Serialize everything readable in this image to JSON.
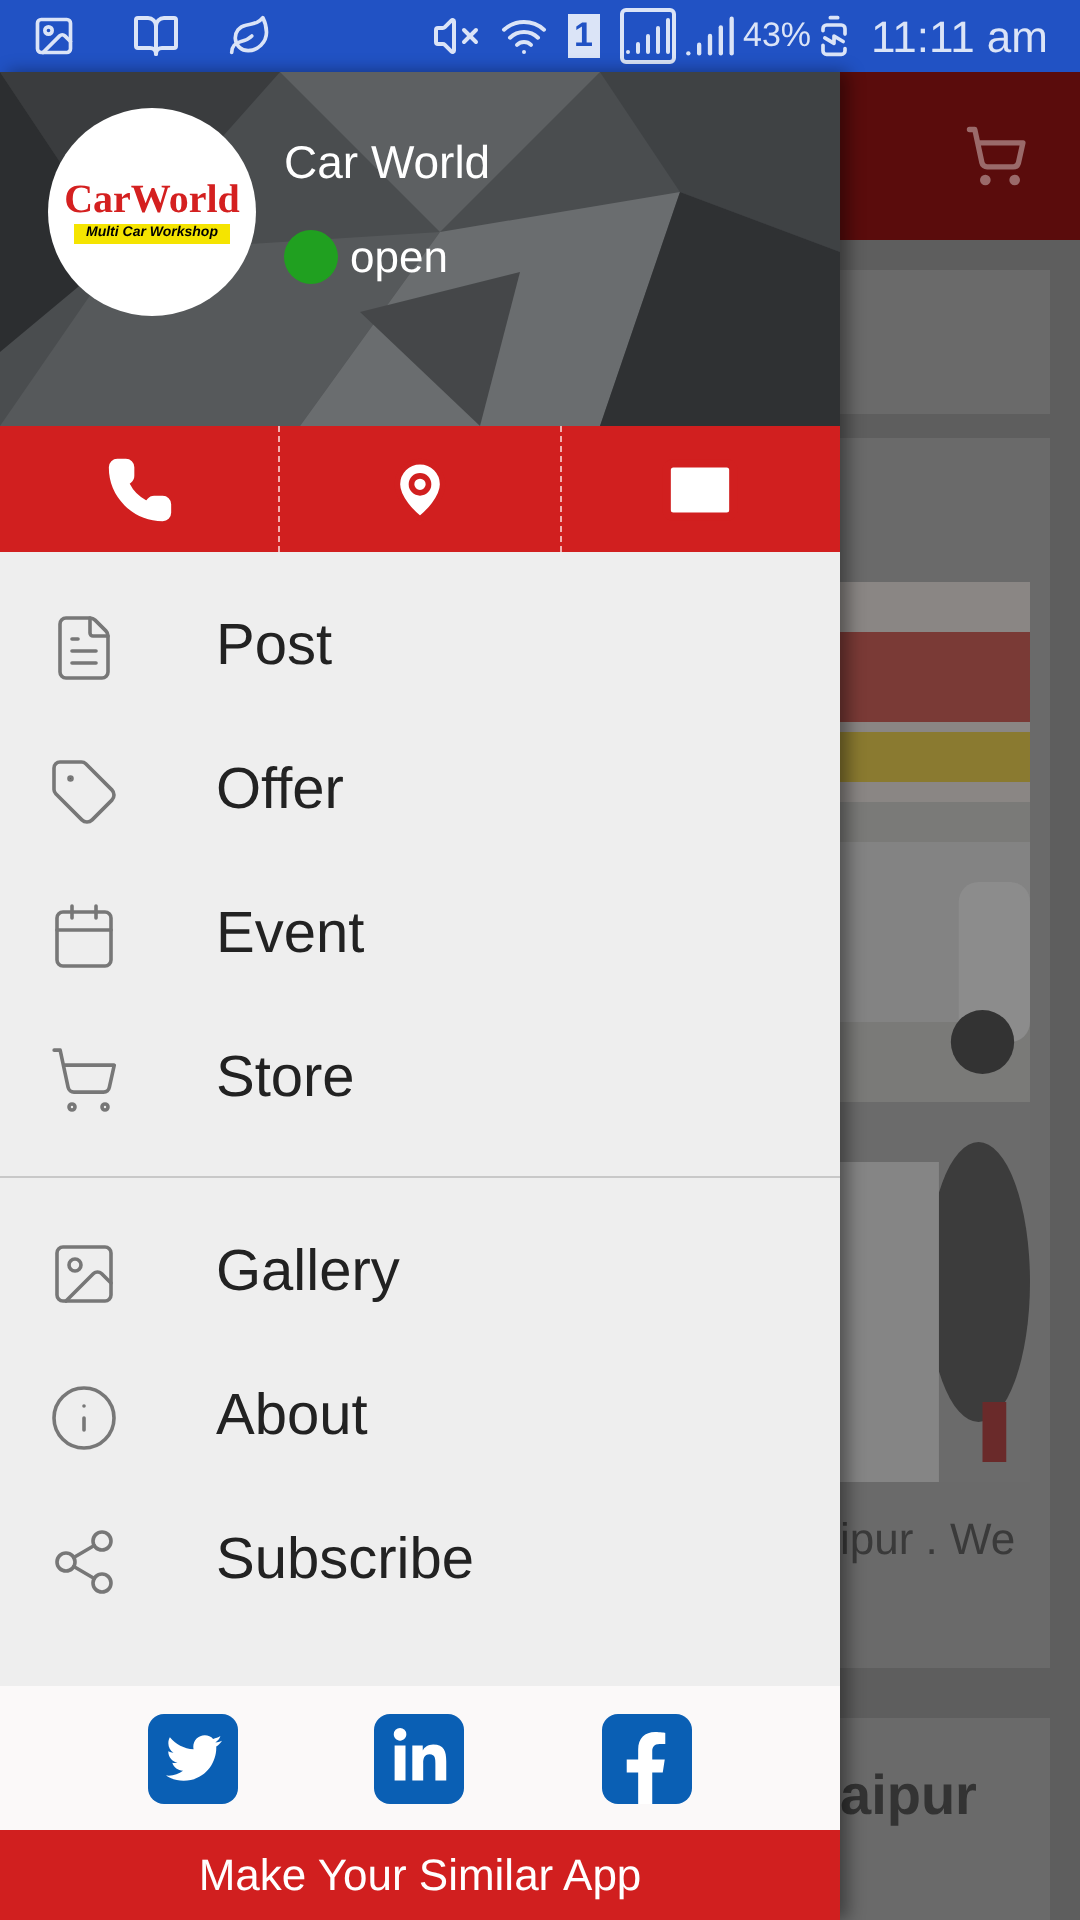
{
  "status_bar": {
    "sim": "1",
    "battery": "43%",
    "time": "11:11 am"
  },
  "drawer": {
    "logo": {
      "name": "CarWorld",
      "tagline": "Multi Car Workshop"
    },
    "business": "Car World",
    "status": {
      "label": "open",
      "open": true
    },
    "sections": [
      [
        {
          "label": "Post"
        },
        {
          "label": "Offer"
        },
        {
          "label": "Event"
        },
        {
          "label": "Store"
        }
      ],
      [
        {
          "label": "Gallery"
        },
        {
          "label": "About"
        },
        {
          "label": "Subscribe"
        }
      ]
    ],
    "footer": "Make Your Similar App"
  },
  "background": {
    "card_text": "ipur . We",
    "heading": "aipur"
  }
}
